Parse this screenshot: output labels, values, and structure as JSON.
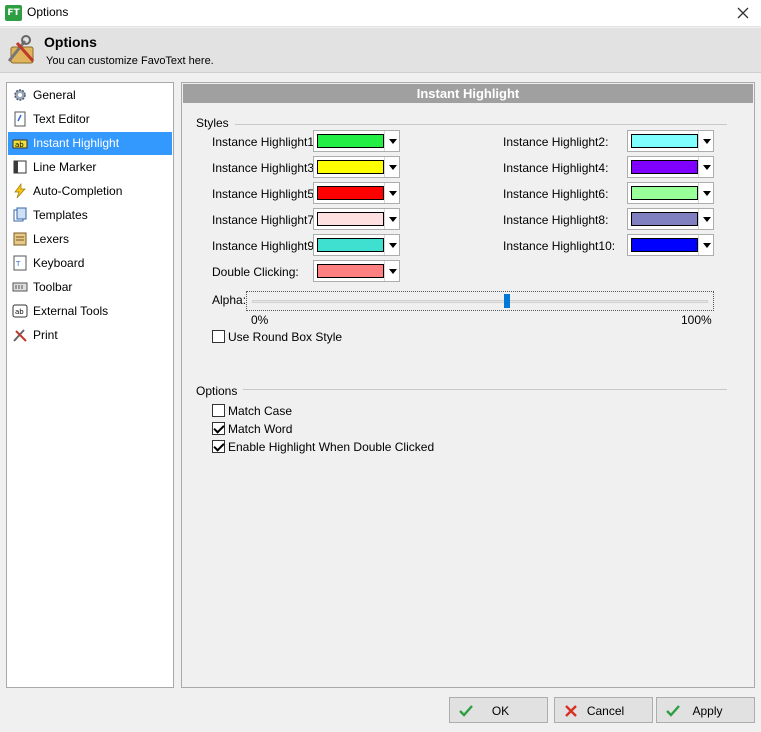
{
  "window": {
    "title": "Options",
    "logo_text": "FT"
  },
  "header": {
    "title": "Options",
    "subtitle": "You can customize FavoText here."
  },
  "sidebar": {
    "items": [
      {
        "label": "General",
        "icon": "gear-icon"
      },
      {
        "label": "Text Editor",
        "icon": "document-icon"
      },
      {
        "label": "Instant Highlight",
        "icon": "highlighter-icon",
        "selected": true
      },
      {
        "label": "Line Marker",
        "icon": "line-marker-icon"
      },
      {
        "label": "Auto-Completion",
        "icon": "lightning-icon"
      },
      {
        "label": "Templates",
        "icon": "templates-icon"
      },
      {
        "label": "Lexers",
        "icon": "lexers-icon"
      },
      {
        "label": "Keyboard",
        "icon": "keyboard-icon"
      },
      {
        "label": "Toolbar",
        "icon": "toolbar-icon"
      },
      {
        "label": "External Tools",
        "icon": "ab-icon"
      },
      {
        "label": "Print",
        "icon": "tools-icon"
      }
    ]
  },
  "main": {
    "title": "Instant Highlight",
    "styles": {
      "group_label": "Styles",
      "highlights": [
        {
          "label": "Instance Highlight1:",
          "color": "#22ee44"
        },
        {
          "label": "Instance Highlight2:",
          "color": "#80ffff"
        },
        {
          "label": "Instance Highlight3:",
          "color": "#ffff00"
        },
        {
          "label": "Instance Highlight4:",
          "color": "#8000ff"
        },
        {
          "label": "Instance Highlight5:",
          "color": "#ff0000"
        },
        {
          "label": "Instance Highlight6:",
          "color": "#99ff99"
        },
        {
          "label": "Instance Highlight7:",
          "color": "#ffe0e0"
        },
        {
          "label": "Instance Highlight8:",
          "color": "#8080c0"
        },
        {
          "label": "Instance Highlight9:",
          "color": "#40e0d0"
        },
        {
          "label": "Instance Highlight10:",
          "color": "#0000ff"
        }
      ],
      "double_clicking": {
        "label": "Double Clicking:",
        "color": "#ff8080"
      },
      "alpha": {
        "label": "Alpha:",
        "min_label": "0%",
        "max_label": "100%",
        "value_percent": 56
      },
      "round_box": {
        "label": "Use Round Box Style",
        "checked": false
      }
    },
    "options": {
      "group_label": "Options",
      "items": [
        {
          "label": "Match Case",
          "checked": false
        },
        {
          "label": "Match Word",
          "checked": true
        },
        {
          "label": "Enable Highlight When Double Clicked",
          "checked": true
        }
      ]
    }
  },
  "buttons": {
    "ok": "OK",
    "cancel": "Cancel",
    "apply": "Apply"
  }
}
